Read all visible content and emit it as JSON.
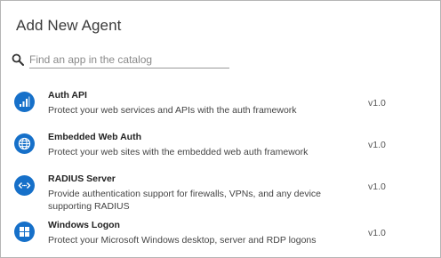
{
  "dialog": {
    "title": "Add New Agent"
  },
  "search": {
    "icon": "search-icon",
    "placeholder": "Find an app in the catalog",
    "value": ""
  },
  "agents": [
    {
      "name": "Auth API",
      "description": "Protect your web services and APIs with the auth framework",
      "version": "v1.0",
      "icon": "bar-chart-icon",
      "icon_color": "#1670c9"
    },
    {
      "name": "Embedded Web Auth",
      "description": "Protect your web sites with the embedded web auth framework",
      "version": "v1.0",
      "icon": "globe-icon",
      "icon_color": "#1670c9"
    },
    {
      "name": "RADIUS Server",
      "description": "Provide authentication support for firewalls, VPNs, and any device supporting RADIUS",
      "version": "v1.0",
      "icon": "code-arrows-icon",
      "icon_color": "#1670c9"
    },
    {
      "name": "Windows Logon",
      "description": "Protect your Microsoft Windows desktop, server and RDP logons",
      "version": "v1.0",
      "icon": "windows-icon",
      "icon_color": "#1670c9"
    }
  ]
}
